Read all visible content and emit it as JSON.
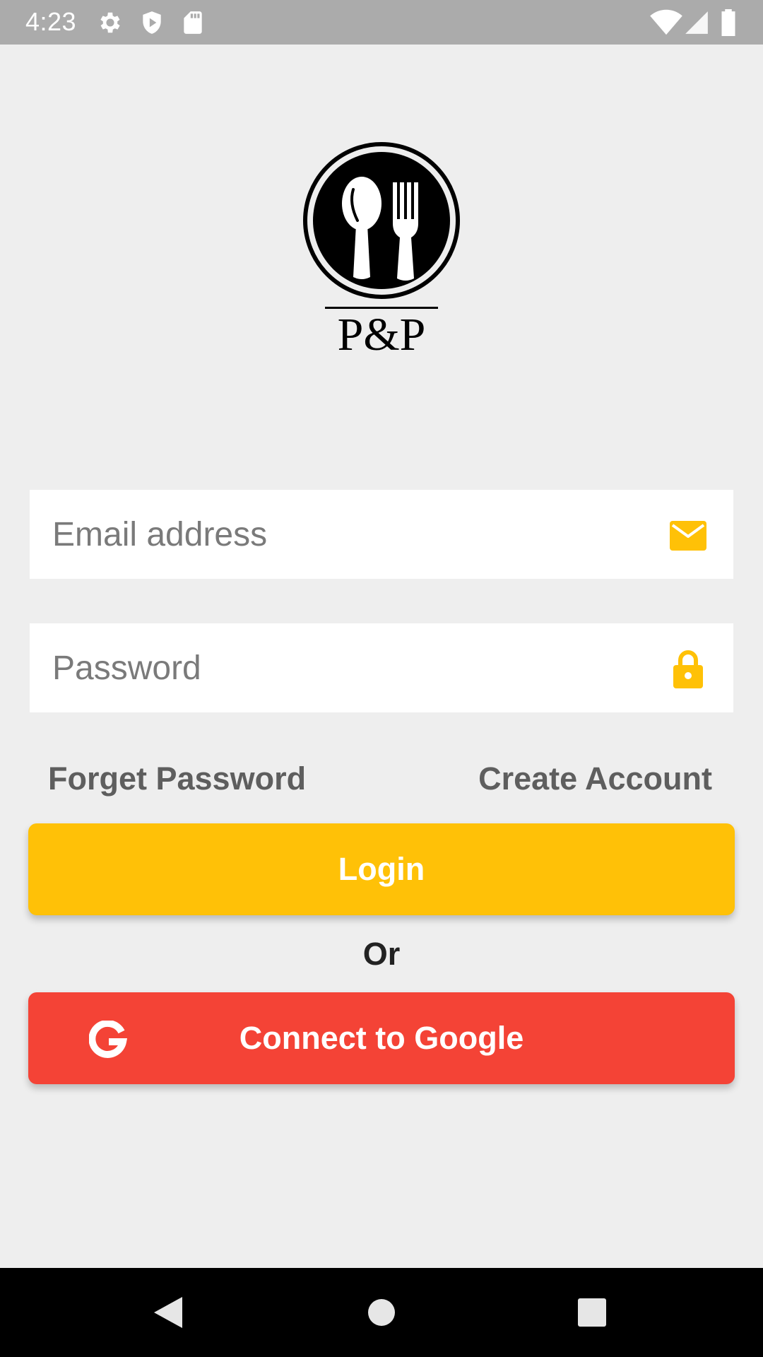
{
  "status_bar": {
    "time": "4:23",
    "icons": [
      "gear-icon",
      "shield-icon",
      "sd-card-icon",
      "wifi-icon",
      "signal-icon",
      "battery-icon"
    ]
  },
  "logo": {
    "text": "P&P",
    "icon": "spoon-fork-plate-icon"
  },
  "form": {
    "email_placeholder": "Email address",
    "email_value": "",
    "email_icon": "mail-icon",
    "password_placeholder": "Password",
    "password_value": "",
    "password_icon": "lock-icon"
  },
  "links": {
    "forget_password": "Forget Password",
    "create_account": "Create Account"
  },
  "buttons": {
    "login_label": "Login",
    "or_label": "Or",
    "google_label": "Connect to Google",
    "google_icon": "google-g-icon"
  },
  "nav_bar": {
    "icons": [
      "back-icon",
      "home-icon",
      "recents-icon"
    ]
  },
  "colors": {
    "accent_yellow": "#FFC107",
    "google_red": "#F44336",
    "background": "#EEEEEE",
    "status_bar": "#ABABAB",
    "link_gray": "#5E5E5E"
  }
}
